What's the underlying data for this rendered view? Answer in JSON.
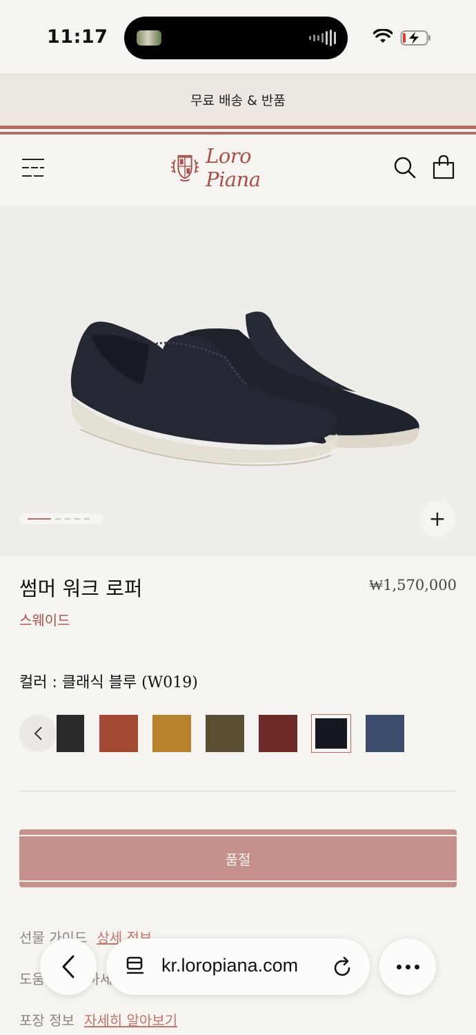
{
  "status_bar": {
    "time": "11:17",
    "icons": [
      "media-thumbnail-icon",
      "audio-bars-icon",
      "wifi-icon",
      "battery-charging-icon"
    ]
  },
  "promo": {
    "text": "무료 배송 & 반품"
  },
  "header": {
    "brand": "Loro Piana",
    "icons": [
      "menu-icon",
      "brand-crest-icon",
      "search-icon",
      "bag-icon"
    ]
  },
  "gallery": {
    "image_subject": "navy suede loafers",
    "current_image_index": 1,
    "image_count": 5,
    "zoom_label": "+"
  },
  "product": {
    "title": "썸머 워크 로퍼",
    "price": "₩1,570,000",
    "material": "스웨이드"
  },
  "color": {
    "label": "컬러 : 클래식 블루 ",
    "code": "(W019)",
    "swatches": [
      {
        "name": "black",
        "hex": "#2b2a2a",
        "selected": false
      },
      {
        "name": "rust",
        "hex": "#a44a33",
        "selected": false
      },
      {
        "name": "tan",
        "hex": "#b7822e",
        "selected": false
      },
      {
        "name": "olive-brown",
        "hex": "#5a4e33",
        "selected": false
      },
      {
        "name": "burgundy",
        "hex": "#6d2a27",
        "selected": false
      },
      {
        "name": "classic-blue",
        "hex": "#141620",
        "selected": true
      },
      {
        "name": "denim-blue",
        "hex": "#3b4b6b",
        "selected": false
      }
    ]
  },
  "actions": {
    "soldout_label": "품절"
  },
  "info": {
    "gift_label": "선물 가이드",
    "gift_link": "상세 정보",
    "help_label": "도움이 필요하세요?",
    "help_link": "문의",
    "packaging_label": "포장 정보",
    "packaging_link": "자세히 알아보기"
  },
  "browser": {
    "url": "kr.loropiana.com"
  },
  "colors": {
    "accent": "#b76a5f",
    "brand": "#a94f47",
    "button_soldout": "#c4918a",
    "background": "#f6f4f1"
  }
}
